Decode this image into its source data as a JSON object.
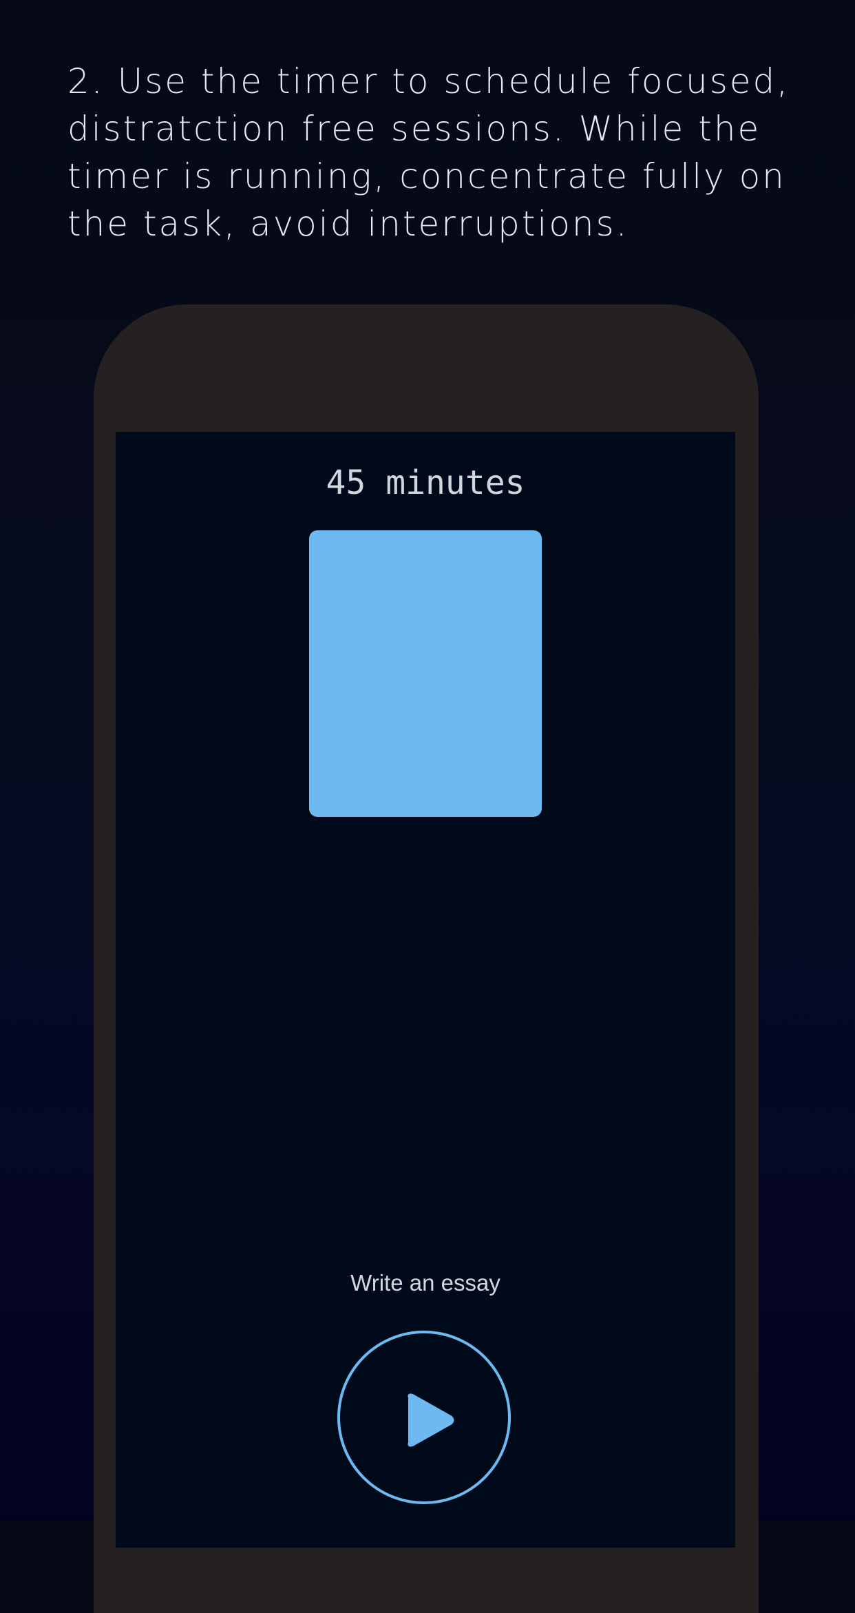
{
  "instruction": {
    "text": "2. Use the timer to schedule focused, distratction free sessions. While the timer is running, concentrate fully on the task, avoid interruptions."
  },
  "timer": {
    "duration_label": "45 minutes",
    "remaining_fraction": 1.0,
    "block_color": "#6db9f2"
  },
  "task": {
    "label": "Write an essay"
  },
  "controls": {
    "play_icon": "play-icon",
    "accent_color": "#6db9f2"
  },
  "colors": {
    "background": "#050915",
    "phone_frame": "#242120",
    "screen": "#010a1b",
    "text": "#e6e8f2"
  }
}
